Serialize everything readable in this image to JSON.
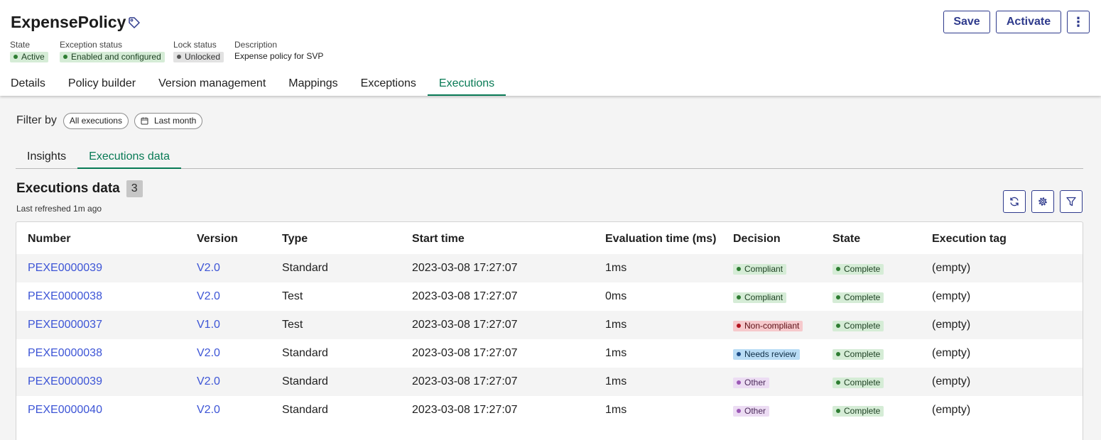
{
  "record": {
    "title": "ExpensePolicy",
    "meta": [
      {
        "label": "State",
        "value": "Active",
        "color": "green"
      },
      {
        "label": "Exception status",
        "value": "Enabled and configured",
        "color": "green"
      },
      {
        "label": "Lock status",
        "value": "Unlocked",
        "color": "gray"
      }
    ],
    "description_label": "Description",
    "description_value": "Expense policy for SVP"
  },
  "actions": {
    "save": "Save",
    "activate": "Activate",
    "more": "⋮"
  },
  "tabs": [
    "Details",
    "Policy builder",
    "Version management",
    "Mappings",
    "Exceptions",
    "Executions"
  ],
  "active_tab": "Executions",
  "filter": {
    "label": "Filter by",
    "pills": [
      "All executions",
      "Last month"
    ]
  },
  "subtabs": [
    "Insights",
    "Executions data"
  ],
  "list": {
    "title": "Executions data",
    "count": "3",
    "refreshed": "Last refreshed 1m ago"
  },
  "table": {
    "columns": [
      "Number",
      "Version",
      "Type",
      "Start time",
      "Evaluation time (ms)",
      "Decision",
      "State",
      "Execution tag"
    ],
    "rows": [
      {
        "number": "PEXE0000039",
        "version": "V2.0",
        "type": "Standard",
        "start": "2023-03-08 17:27:07",
        "eval": "1ms",
        "decision": "Compliant",
        "decision_color": "green",
        "state": "Complete",
        "tag": "(empty)"
      },
      {
        "number": "PEXE0000038",
        "version": "V2.0",
        "type": "Test",
        "start": "2023-03-08 17:27:07",
        "eval": "0ms",
        "decision": "Compliant",
        "decision_color": "green",
        "state": "Complete",
        "tag": "(empty)"
      },
      {
        "number": "PEXE0000037",
        "version": "V1.0",
        "type": "Test",
        "start": "2023-03-08 17:27:07",
        "eval": "1ms",
        "decision": "Non-compliant",
        "decision_color": "red",
        "state": "Complete",
        "tag": "(empty)"
      },
      {
        "number": "PEXE0000038",
        "version": "V2.0",
        "type": "Standard",
        "start": "2023-03-08 17:27:07",
        "eval": "1ms",
        "decision": "Needs review",
        "decision_color": "blue",
        "state": "Complete",
        "tag": "(empty)"
      },
      {
        "number": "PEXE0000039",
        "version": "V2.0",
        "type": "Standard",
        "start": "2023-03-08 17:27:07",
        "eval": "1ms",
        "decision": "Other",
        "decision_color": "purple",
        "state": "Complete",
        "tag": "(empty)"
      },
      {
        "number": "PEXE0000040",
        "version": "V2.0",
        "type": "Standard",
        "start": "2023-03-08 17:27:07",
        "eval": "1ms",
        "decision": "Other",
        "decision_color": "purple",
        "state": "Complete",
        "tag": "(empty)"
      }
    ]
  },
  "colors": {
    "accent": "#087a55",
    "button": "#2e3a8c",
    "link": "#3d55d6"
  },
  "icons": [
    "tag-icon",
    "calendar-icon",
    "refresh-icon",
    "gear-icon",
    "filter-icon",
    "more-vertical-icon"
  ]
}
